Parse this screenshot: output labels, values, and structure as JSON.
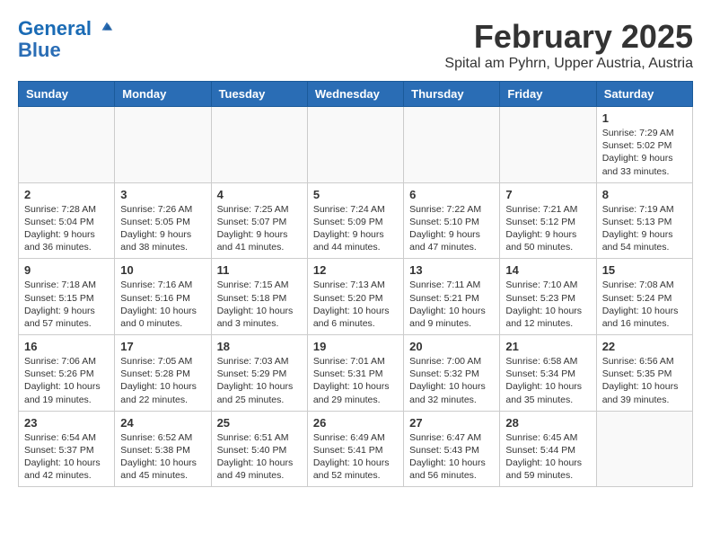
{
  "header": {
    "logo_line1": "General",
    "logo_line2": "Blue",
    "title": "February 2025",
    "subtitle": "Spital am Pyhrn, Upper Austria, Austria"
  },
  "weekdays": [
    "Sunday",
    "Monday",
    "Tuesday",
    "Wednesday",
    "Thursday",
    "Friday",
    "Saturday"
  ],
  "weeks": [
    [
      {
        "day": "",
        "info": ""
      },
      {
        "day": "",
        "info": ""
      },
      {
        "day": "",
        "info": ""
      },
      {
        "day": "",
        "info": ""
      },
      {
        "day": "",
        "info": ""
      },
      {
        "day": "",
        "info": ""
      },
      {
        "day": "1",
        "info": "Sunrise: 7:29 AM\nSunset: 5:02 PM\nDaylight: 9 hours\nand 33 minutes."
      }
    ],
    [
      {
        "day": "2",
        "info": "Sunrise: 7:28 AM\nSunset: 5:04 PM\nDaylight: 9 hours\nand 36 minutes."
      },
      {
        "day": "3",
        "info": "Sunrise: 7:26 AM\nSunset: 5:05 PM\nDaylight: 9 hours\nand 38 minutes."
      },
      {
        "day": "4",
        "info": "Sunrise: 7:25 AM\nSunset: 5:07 PM\nDaylight: 9 hours\nand 41 minutes."
      },
      {
        "day": "5",
        "info": "Sunrise: 7:24 AM\nSunset: 5:09 PM\nDaylight: 9 hours\nand 44 minutes."
      },
      {
        "day": "6",
        "info": "Sunrise: 7:22 AM\nSunset: 5:10 PM\nDaylight: 9 hours\nand 47 minutes."
      },
      {
        "day": "7",
        "info": "Sunrise: 7:21 AM\nSunset: 5:12 PM\nDaylight: 9 hours\nand 50 minutes."
      },
      {
        "day": "8",
        "info": "Sunrise: 7:19 AM\nSunset: 5:13 PM\nDaylight: 9 hours\nand 54 minutes."
      }
    ],
    [
      {
        "day": "9",
        "info": "Sunrise: 7:18 AM\nSunset: 5:15 PM\nDaylight: 9 hours\nand 57 minutes."
      },
      {
        "day": "10",
        "info": "Sunrise: 7:16 AM\nSunset: 5:16 PM\nDaylight: 10 hours\nand 0 minutes."
      },
      {
        "day": "11",
        "info": "Sunrise: 7:15 AM\nSunset: 5:18 PM\nDaylight: 10 hours\nand 3 minutes."
      },
      {
        "day": "12",
        "info": "Sunrise: 7:13 AM\nSunset: 5:20 PM\nDaylight: 10 hours\nand 6 minutes."
      },
      {
        "day": "13",
        "info": "Sunrise: 7:11 AM\nSunset: 5:21 PM\nDaylight: 10 hours\nand 9 minutes."
      },
      {
        "day": "14",
        "info": "Sunrise: 7:10 AM\nSunset: 5:23 PM\nDaylight: 10 hours\nand 12 minutes."
      },
      {
        "day": "15",
        "info": "Sunrise: 7:08 AM\nSunset: 5:24 PM\nDaylight: 10 hours\nand 16 minutes."
      }
    ],
    [
      {
        "day": "16",
        "info": "Sunrise: 7:06 AM\nSunset: 5:26 PM\nDaylight: 10 hours\nand 19 minutes."
      },
      {
        "day": "17",
        "info": "Sunrise: 7:05 AM\nSunset: 5:28 PM\nDaylight: 10 hours\nand 22 minutes."
      },
      {
        "day": "18",
        "info": "Sunrise: 7:03 AM\nSunset: 5:29 PM\nDaylight: 10 hours\nand 25 minutes."
      },
      {
        "day": "19",
        "info": "Sunrise: 7:01 AM\nSunset: 5:31 PM\nDaylight: 10 hours\nand 29 minutes."
      },
      {
        "day": "20",
        "info": "Sunrise: 7:00 AM\nSunset: 5:32 PM\nDaylight: 10 hours\nand 32 minutes."
      },
      {
        "day": "21",
        "info": "Sunrise: 6:58 AM\nSunset: 5:34 PM\nDaylight: 10 hours\nand 35 minutes."
      },
      {
        "day": "22",
        "info": "Sunrise: 6:56 AM\nSunset: 5:35 PM\nDaylight: 10 hours\nand 39 minutes."
      }
    ],
    [
      {
        "day": "23",
        "info": "Sunrise: 6:54 AM\nSunset: 5:37 PM\nDaylight: 10 hours\nand 42 minutes."
      },
      {
        "day": "24",
        "info": "Sunrise: 6:52 AM\nSunset: 5:38 PM\nDaylight: 10 hours\nand 45 minutes."
      },
      {
        "day": "25",
        "info": "Sunrise: 6:51 AM\nSunset: 5:40 PM\nDaylight: 10 hours\nand 49 minutes."
      },
      {
        "day": "26",
        "info": "Sunrise: 6:49 AM\nSunset: 5:41 PM\nDaylight: 10 hours\nand 52 minutes."
      },
      {
        "day": "27",
        "info": "Sunrise: 6:47 AM\nSunset: 5:43 PM\nDaylight: 10 hours\nand 56 minutes."
      },
      {
        "day": "28",
        "info": "Sunrise: 6:45 AM\nSunset: 5:44 PM\nDaylight: 10 hours\nand 59 minutes."
      },
      {
        "day": "",
        "info": ""
      }
    ]
  ]
}
